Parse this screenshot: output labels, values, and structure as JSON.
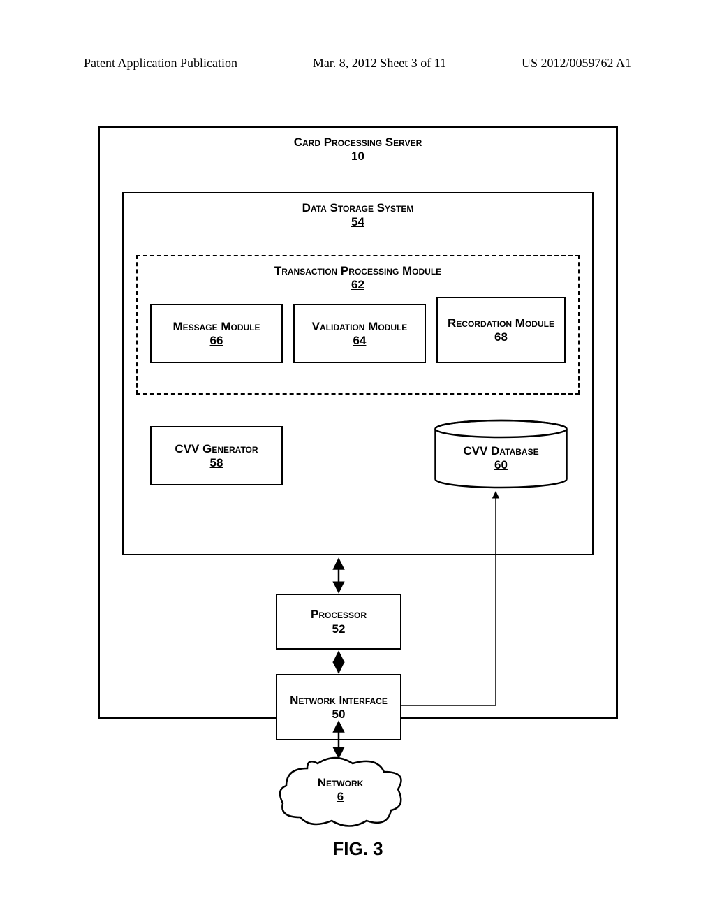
{
  "header": {
    "left": "Patent Application Publication",
    "center": "Mar. 8, 2012  Sheet 3 of 11",
    "right": "US 2012/0059762 A1"
  },
  "diagram": {
    "card_server": {
      "label": "Card Processing Server",
      "num": "10"
    },
    "data_storage": {
      "label": "Data Storage System",
      "num": "54"
    },
    "tp_module": {
      "label": "Transaction Processing Module",
      "num": "62"
    },
    "msg_module": {
      "label": "Message Module",
      "num": "66"
    },
    "val_module": {
      "label": "Validation Module",
      "num": "64"
    },
    "rec_module": {
      "label": "Recordation Module",
      "num": "68"
    },
    "cvv_gen": {
      "label": "CVV Generator",
      "num": "58"
    },
    "cvv_db": {
      "label": "CVV Database",
      "num": "60"
    },
    "processor": {
      "label": "Processor",
      "num": "52"
    },
    "net_if": {
      "label": "Network Interface",
      "num": "50"
    },
    "network": {
      "label": "Network",
      "num": "6"
    }
  },
  "figure_label": "FIG. 3"
}
